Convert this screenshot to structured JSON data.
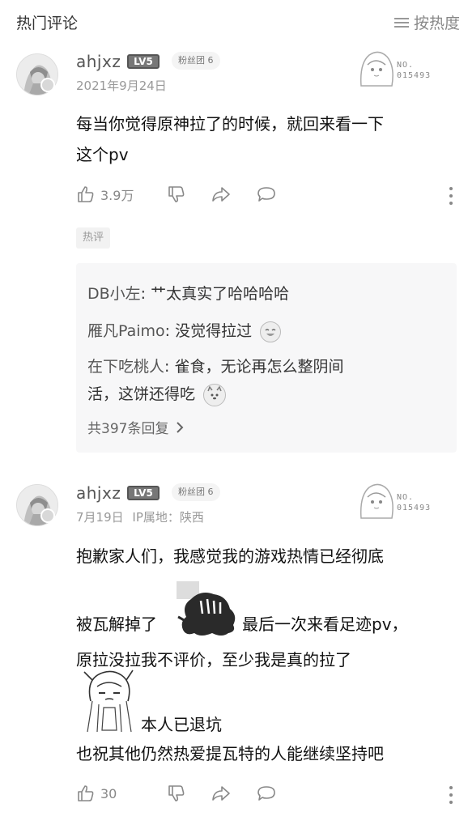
{
  "header": {
    "title": "热门评论",
    "sort_label": "按热度"
  },
  "comments": [
    {
      "username": "ahjxz",
      "level": "LV5",
      "fan_badge": "粉丝团 6",
      "date": "2021年9月24日",
      "deco_number": "NO.\n015493",
      "content": [
        "每当你觉得原神拉了的时候，就回来看一下",
        "这个pv"
      ],
      "likes": "3.9万",
      "tag": "热评",
      "replies": [
        {
          "name": "DB小左",
          "sep": ": ",
          "text": "艹太真实了哈哈哈哈"
        },
        {
          "name": "雁凡Paimo",
          "sep": ": ",
          "text": "没觉得拉过"
        },
        {
          "name": "在下吃桃人",
          "sep": ": ",
          "text": "雀食，无论再怎么整阴间"
        },
        {
          "name": "",
          "sep": "",
          "text": "活，这饼还得吃"
        }
      ],
      "reply_count": "共397条回复"
    },
    {
      "username": "ahjxz",
      "level": "LV5",
      "fan_badge": "粉丝团 6",
      "date": "7月19日",
      "ip": "IP属地：陕西",
      "deco_number": "NO.\n015493",
      "content_lines": [
        "抱歉家人们，我感觉我的游戏热情已经彻底",
        "被瓦解掉了",
        "最后一次来看足迹pv，",
        "原拉没拉我不评价，至少我是真的拉了",
        "本人已退坑",
        "也祝其他仍然热爱提瓦特的人能继续坚持吧"
      ],
      "likes": "30"
    }
  ],
  "icons": {
    "sort": "menu-lines-icon",
    "like": "thumb-up-icon",
    "dislike": "thumb-down-icon",
    "share": "share-icon",
    "reply": "chat-bubble-icon",
    "more": "more-vertical-icon"
  }
}
